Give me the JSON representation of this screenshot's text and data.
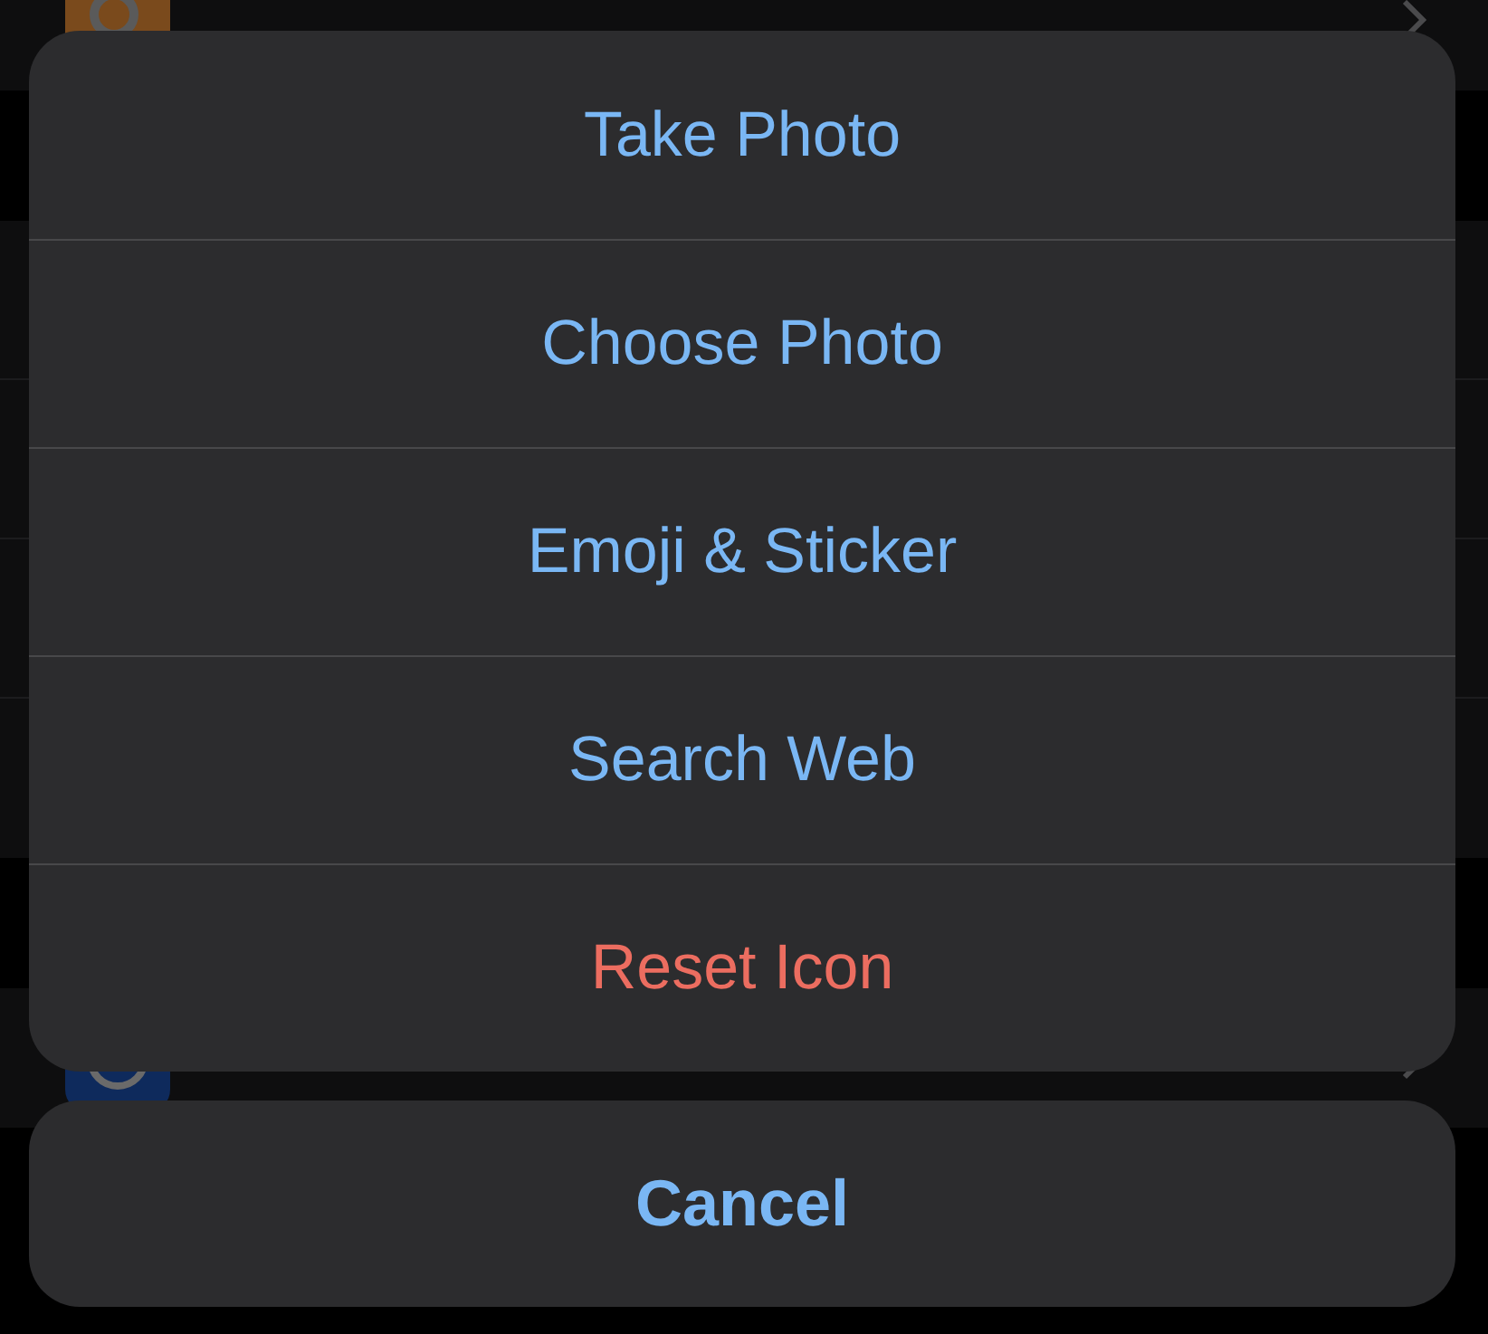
{
  "action_sheet": {
    "actions": [
      {
        "label": "Take Photo",
        "kind": "default"
      },
      {
        "label": "Choose Photo",
        "kind": "default"
      },
      {
        "label": "Emoji & Sticker",
        "kind": "default"
      },
      {
        "label": "Search Web",
        "kind": "default"
      },
      {
        "label": "Reset Icon",
        "kind": "destructive"
      }
    ],
    "cancel": {
      "label": "Cancel"
    }
  }
}
